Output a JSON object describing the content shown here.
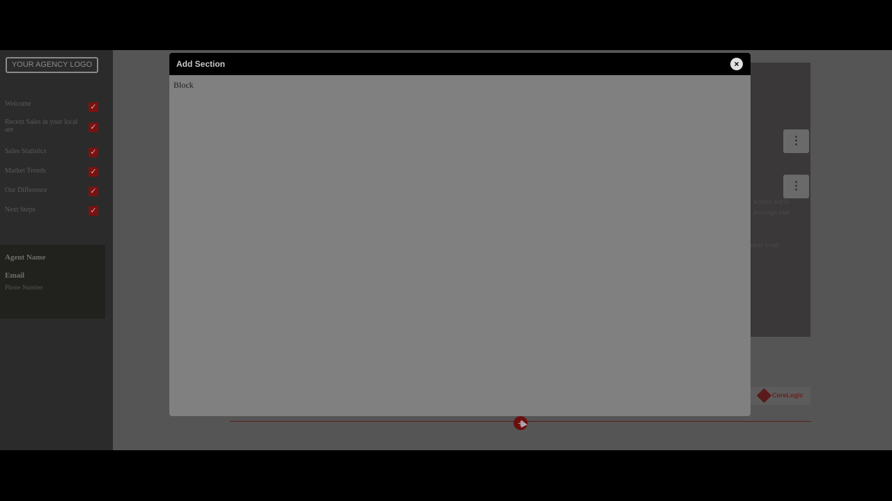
{
  "sidebar": {
    "logo_label": "YOUR AGENCY LOGO",
    "items": [
      {
        "label": "Welcome",
        "checked": true
      },
      {
        "label": "Recent Sales in your local are",
        "checked": true
      },
      {
        "label": "Sales Statistics",
        "checked": true
      },
      {
        "label": "Market Trends",
        "checked": true
      },
      {
        "label": "Our Difference",
        "checked": true
      },
      {
        "label": "Next Steps",
        "checked": true
      }
    ],
    "check_glyph": "✓",
    "agent": {
      "name": "Agent Name",
      "email": "Email",
      "phone": "Phone Number"
    }
  },
  "content": {
    "menu_glyph": "⋮",
    "snippet_lines": [
      "where we'll",
      "everage our",
      "",
      "uest your"
    ],
    "brand": "CoreLogic",
    "add_glyph": "+"
  },
  "modal": {
    "title": "Add Section",
    "close_glyph": "×",
    "block_label": "Block"
  },
  "colors": {
    "accent": "#7a1212",
    "overlay": "#000000"
  }
}
